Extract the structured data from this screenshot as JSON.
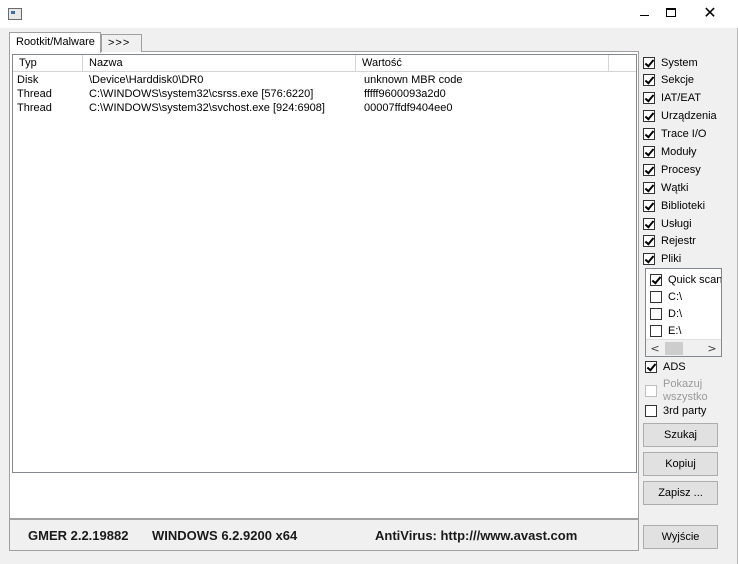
{
  "window": {
    "icon": "app-window-icon",
    "controls": {
      "minimize": "minimize-icon",
      "maximize": "maximize-icon",
      "close_label": "✕"
    }
  },
  "tabs": [
    {
      "label": "Rootkit/Malware",
      "active": true
    },
    {
      "label": ">>>",
      "active": false
    }
  ],
  "list": {
    "columns": [
      "Typ",
      "Nazwa",
      "Wartość",
      ""
    ],
    "rows": [
      {
        "typ": "Disk",
        "nazwa": "\\Device\\Harddisk0\\DR0",
        "wartosc": "unknown MBR code"
      },
      {
        "typ": "Thread",
        "nazwa": "C:\\WINDOWS\\system32\\csrss.exe [576:6220]",
        "wartosc": "fffff9600093a2d0"
      },
      {
        "typ": "Thread",
        "nazwa": "C:\\WINDOWS\\system32\\svchost.exe [924:6908]",
        "wartosc": "00007ffdf9404ee0"
      }
    ]
  },
  "options": [
    {
      "label": "System",
      "checked": true
    },
    {
      "label": "Sekcje",
      "checked": true
    },
    {
      "label": "IAT/EAT",
      "checked": true
    },
    {
      "label": "Urządzenia",
      "checked": true
    },
    {
      "label": "Trace I/O",
      "checked": true
    },
    {
      "label": "Moduły",
      "checked": true
    },
    {
      "label": "Procesy",
      "checked": true
    },
    {
      "label": "Wątki",
      "checked": true
    },
    {
      "label": "Biblioteki",
      "checked": true
    },
    {
      "label": "Usługi",
      "checked": true
    },
    {
      "label": "Rejestr",
      "checked": true
    },
    {
      "label": "Pliki",
      "checked": true
    }
  ],
  "drives": [
    {
      "label": "Quick scan",
      "checked": true
    },
    {
      "label": "C:\\",
      "checked": false
    },
    {
      "label": "D:\\",
      "checked": false
    },
    {
      "label": "E:\\",
      "checked": false
    }
  ],
  "scroll": {
    "left": "<",
    "right": ">"
  },
  "extra_options": {
    "ads": {
      "label": "ADS",
      "checked": true
    },
    "show_all": {
      "label_line1": "Pokazuj",
      "label_line2": "wszystko",
      "checked": false,
      "disabled": true
    },
    "third_party": {
      "label": "3rd party",
      "checked": false
    }
  },
  "buttons": {
    "scan": "Szukaj",
    "copy": "Kopiuj",
    "save": "Zapisz ...",
    "exit": "Wyjście"
  },
  "status": {
    "version": "GMER 2.2.19882",
    "os": "WINDOWS 6.2.9200  x64",
    "antivirus": "AntiVirus: http:///www.avast.com"
  }
}
